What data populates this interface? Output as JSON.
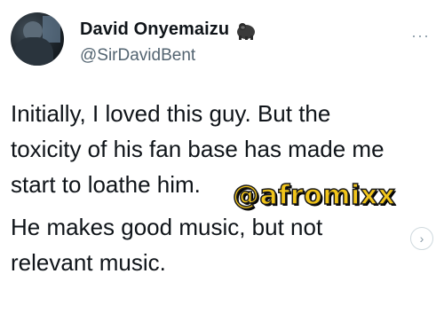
{
  "author": {
    "display_name": "David Onyemaizu",
    "handle": "@SirDavidBent",
    "badge_icon": "gorilla-emoji-icon"
  },
  "more_label": "···",
  "tweet": {
    "lines": [
      "Initially, I loved this guy. But the",
      "toxicity of his fan base has made me",
      "start to loathe him.",
      "He makes good music, but not",
      "relevant music."
    ]
  },
  "watermark": "@afromixx",
  "colors": {
    "text": "#0f1419",
    "secondary": "#536471",
    "watermark_fill": "#f2c51a"
  }
}
